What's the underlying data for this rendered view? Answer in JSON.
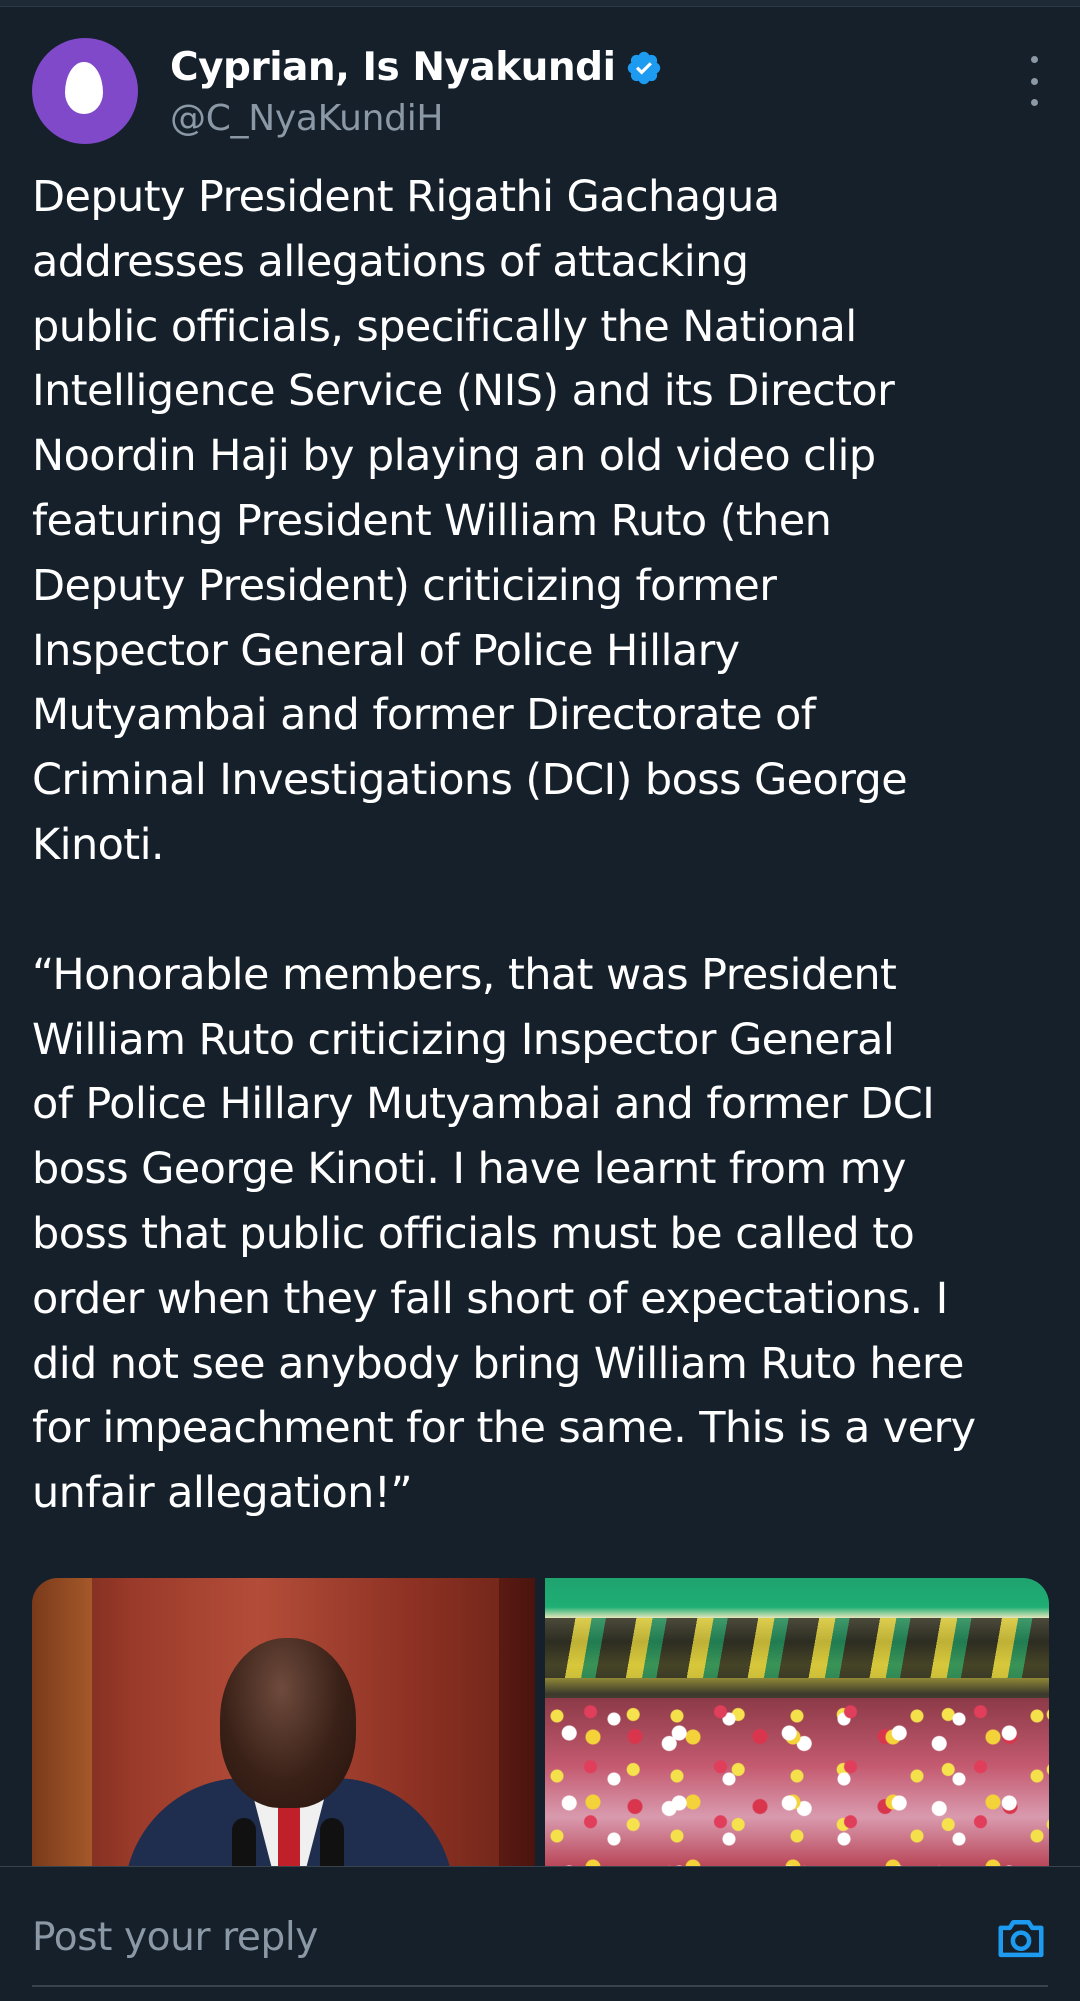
{
  "post": {
    "author": {
      "display_name": "Cyprian, Is Nyakundi",
      "handle": "@C_NyaKundiH",
      "verified": true,
      "avatar_color": "#7f49c9"
    },
    "more_options_icon": "vertical-ellipsis-icon",
    "body_lines_1": [
      "Deputy President Rigathi Gachagua",
      "addresses allegations of attacking",
      "public officials, specifically the National",
      "Intelligence Service (NIS) and its Director",
      "Noordin Haji by playing an old video clip",
      "featuring President William Ruto (then",
      "Deputy President) criticizing former",
      "Inspector General of Police Hillary",
      "Mutyambai and former Directorate of",
      "Criminal Investigations (DCI) boss George",
      "Kinoti."
    ],
    "body_lines_2": [
      "“Honorable members, that was President",
      "William Ruto criticizing Inspector General",
      "of Police Hillary Mutyambai and former DCI",
      "boss George Kinoti. I have learnt from my",
      "boss that public officials must be called to",
      "order when they fall short of expectations. I",
      "did not see anybody bring William Ruto here",
      "for impeachment for the same. This is a very",
      "unfair allegation!”"
    ],
    "media": [
      {
        "kind": "photo",
        "subject": "man-speaking-in-parliament"
      },
      {
        "kind": "photo",
        "subject": "crowd-at-rally"
      }
    ]
  },
  "reply": {
    "placeholder": "Post your reply",
    "camera_icon": "camera-icon"
  },
  "colors": {
    "background": "#15202b",
    "text": "#ffffff",
    "secondary_text": "#8b98a5",
    "verified_blue": "#1d9bf0",
    "divider": "#38444d"
  }
}
